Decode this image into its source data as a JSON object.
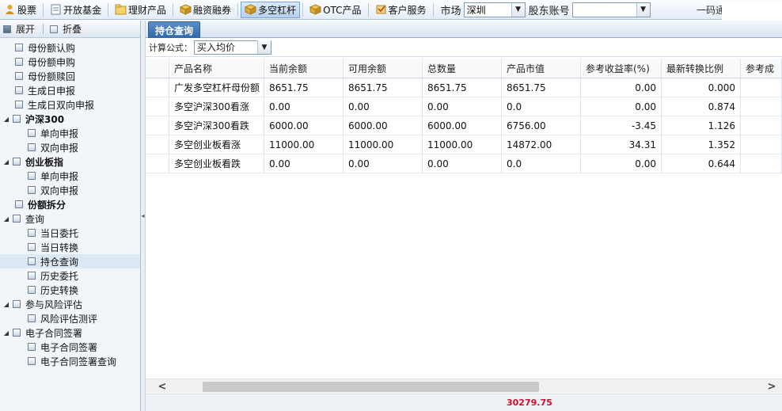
{
  "toolbar": {
    "buttons": [
      {
        "label": "股票",
        "icon": "user-icon"
      },
      {
        "label": "开放基金",
        "icon": "document-icon"
      },
      {
        "label": "理财产品",
        "icon": "folder-icon"
      },
      {
        "label": "融资融券",
        "icon": "box-icon"
      },
      {
        "label": "多空杠杆",
        "icon": "box-icon"
      },
      {
        "label": "OTC产品",
        "icon": "box-icon"
      },
      {
        "label": "客户服务",
        "icon": "service-icon"
      }
    ],
    "active_index": 4,
    "market_label": "市场",
    "market_value": "深圳",
    "account_label": "股东账号",
    "account_value": "",
    "yima_label": "一码通"
  },
  "left_panel": {
    "expand_label": "展开",
    "collapse_label": "折叠",
    "tree": [
      {
        "label": "母份额认购",
        "level": 1,
        "bold": false
      },
      {
        "label": "母份额申购",
        "level": 1,
        "bold": false
      },
      {
        "label": "母份额赎回",
        "level": 1,
        "bold": false
      },
      {
        "label": "生成日申报",
        "level": 1,
        "bold": false
      },
      {
        "label": "生成日双向申报",
        "level": 1,
        "bold": false
      },
      {
        "label": "沪深300",
        "level": 0,
        "bold": true,
        "expanded": true
      },
      {
        "label": "单向申报",
        "level": 2,
        "bold": false
      },
      {
        "label": "双向申报",
        "level": 2,
        "bold": false
      },
      {
        "label": "创业板指",
        "level": 0,
        "bold": true,
        "expanded": true
      },
      {
        "label": "单向申报",
        "level": 2,
        "bold": false
      },
      {
        "label": "双向申报",
        "level": 2,
        "bold": false
      },
      {
        "label": "份额拆分",
        "level": 1,
        "bold": true
      },
      {
        "label": "查询",
        "level": 0,
        "bold": false,
        "expanded": true
      },
      {
        "label": "当日委托",
        "level": 2,
        "bold": false
      },
      {
        "label": "当日转换",
        "level": 2,
        "bold": false
      },
      {
        "label": "持仓查询",
        "level": 2,
        "bold": false,
        "selected": true
      },
      {
        "label": "历史委托",
        "level": 2,
        "bold": false
      },
      {
        "label": "历史转换",
        "level": 2,
        "bold": false
      },
      {
        "label": "参与风险评估",
        "level": 0,
        "bold": false,
        "expanded": true
      },
      {
        "label": "风险评估测评",
        "level": 2,
        "bold": false
      },
      {
        "label": "电子合同签署",
        "level": 0,
        "bold": false,
        "expanded": true
      },
      {
        "label": "电子合同签署",
        "level": 2,
        "bold": false
      },
      {
        "label": "电子合同签署查询",
        "level": 2,
        "bold": false
      }
    ]
  },
  "main": {
    "tab_label": "持仓查询",
    "formula_label": "计算公式：",
    "formula_value": "买入均价",
    "columns": [
      "",
      "产品名称",
      "当前余额",
      "可用余额",
      "总数量",
      "产品市值",
      "参考收益率(%)",
      "最新转换比例",
      "参考成"
    ],
    "rows": [
      [
        "",
        "广发多空杠杆母份额",
        "8651.75",
        "8651.75",
        "8651.75",
        "8651.75",
        "0.00",
        "0.000",
        ""
      ],
      [
        "",
        "多空沪深300看涨",
        "0.00",
        "0.00",
        "0.00",
        "0.0",
        "0.00",
        "0.874",
        ""
      ],
      [
        "",
        "多空沪深300看跌",
        "6000.00",
        "6000.00",
        "6000.00",
        "6756.00",
        "-3.45",
        "1.126",
        ""
      ],
      [
        "",
        "多空创业板看涨",
        "11000.00",
        "11000.00",
        "11000.00",
        "14872.00",
        "34.31",
        "1.352",
        ""
      ],
      [
        "",
        "多空创业板看跌",
        "0.00",
        "0.00",
        "0.00",
        "0.0",
        "0.00",
        "0.644",
        ""
      ]
    ],
    "total": "30279.75"
  }
}
